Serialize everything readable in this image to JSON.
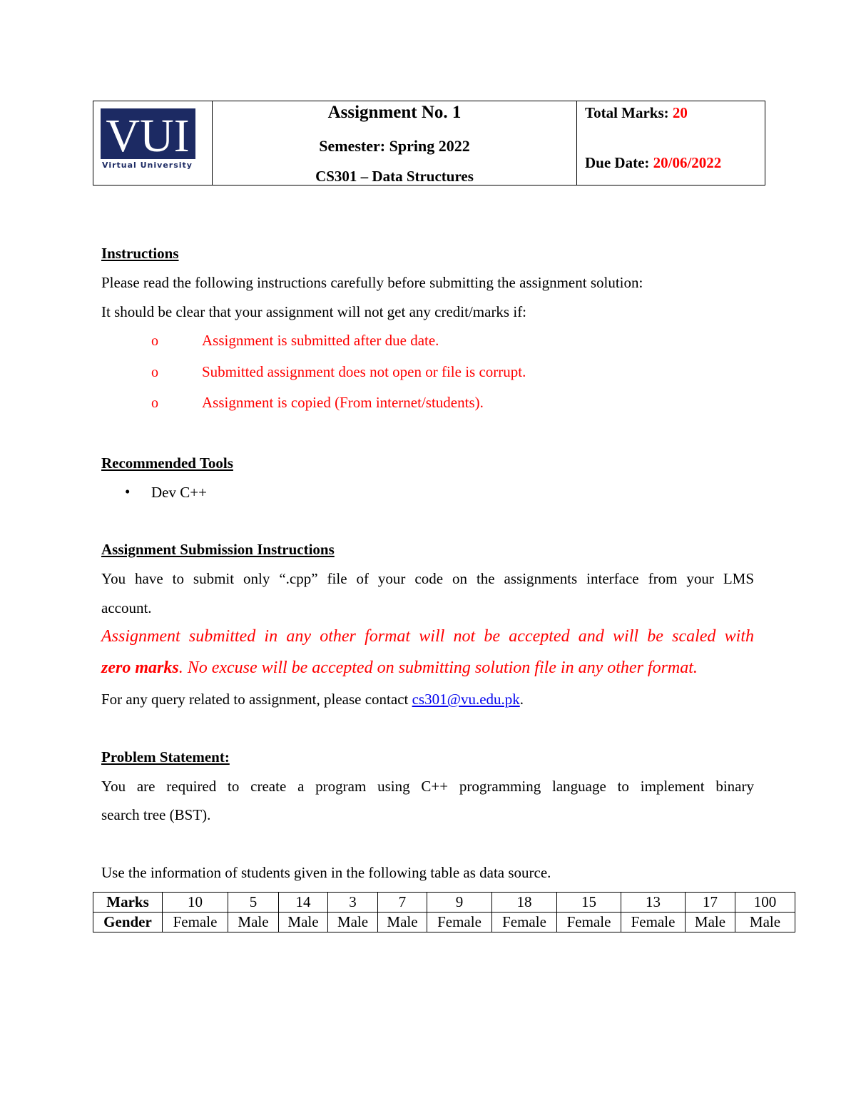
{
  "header": {
    "logo": {
      "text": "VUI",
      "subtitle": "Virtual University",
      "color": "#1c2a63"
    },
    "assignment_title": "Assignment No.  1",
    "semester": "Semester: Spring 2022",
    "course": "CS301 – Data Structures",
    "total_marks_label": "Total Marks: ",
    "total_marks_value": "20",
    "due_date_label": "Due Date:  ",
    "due_date_value": "20/06/2022"
  },
  "instructions": {
    "heading": "Instructions",
    "line1": "Please read the following instructions carefully before submitting the assignment solution:",
    "line2": "It should be clear that your assignment will not get any credit/marks if:",
    "bullet_glyph": "o",
    "items": [
      "Assignment is submitted after due date.",
      "Submitted assignment does not open or file is corrupt.",
      "Assignment is copied (From internet/students)."
    ]
  },
  "tools": {
    "heading": "Recommended Tools",
    "bullet_glyph": "•",
    "items": [
      "Dev C++"
    ]
  },
  "submission": {
    "heading": "Assignment Submission Instructions ",
    "line1": "You have to submit only “.cpp” file of your code on the assignments interface from your LMS",
    "line2": "account.",
    "warning_line1": "Assignment submitted in any other format will not be accepted and will be scaled with",
    "warning_bold": "zero marks",
    "warning_rest": ". No excuse will be accepted on submitting solution file in any other format.",
    "contact_text": "For any query related to assignment, please contact ",
    "contact_email": "cs301@vu.edu.pk",
    "contact_end": "."
  },
  "problem": {
    "heading": "Problem Statement:",
    "line1": "You are required to create a program using C++ programming language to implement binary",
    "line2": "search tree (BST).",
    "table_intro": "Use the information of students given in the following table as data source."
  },
  "students_table": {
    "row_labels": [
      "Marks",
      "Gender"
    ],
    "marks": [
      "10",
      "5",
      "14",
      "3",
      "7",
      "9",
      "18",
      "15",
      "13",
      "17",
      "100"
    ],
    "gender": [
      "Female",
      "Male",
      "Male",
      "Male",
      "Male",
      "Female",
      "Female",
      "Female",
      "Female",
      "Male",
      "Male"
    ]
  },
  "colors": {
    "accent_red": "#ff0000",
    "link_blue": "#0000ee"
  }
}
